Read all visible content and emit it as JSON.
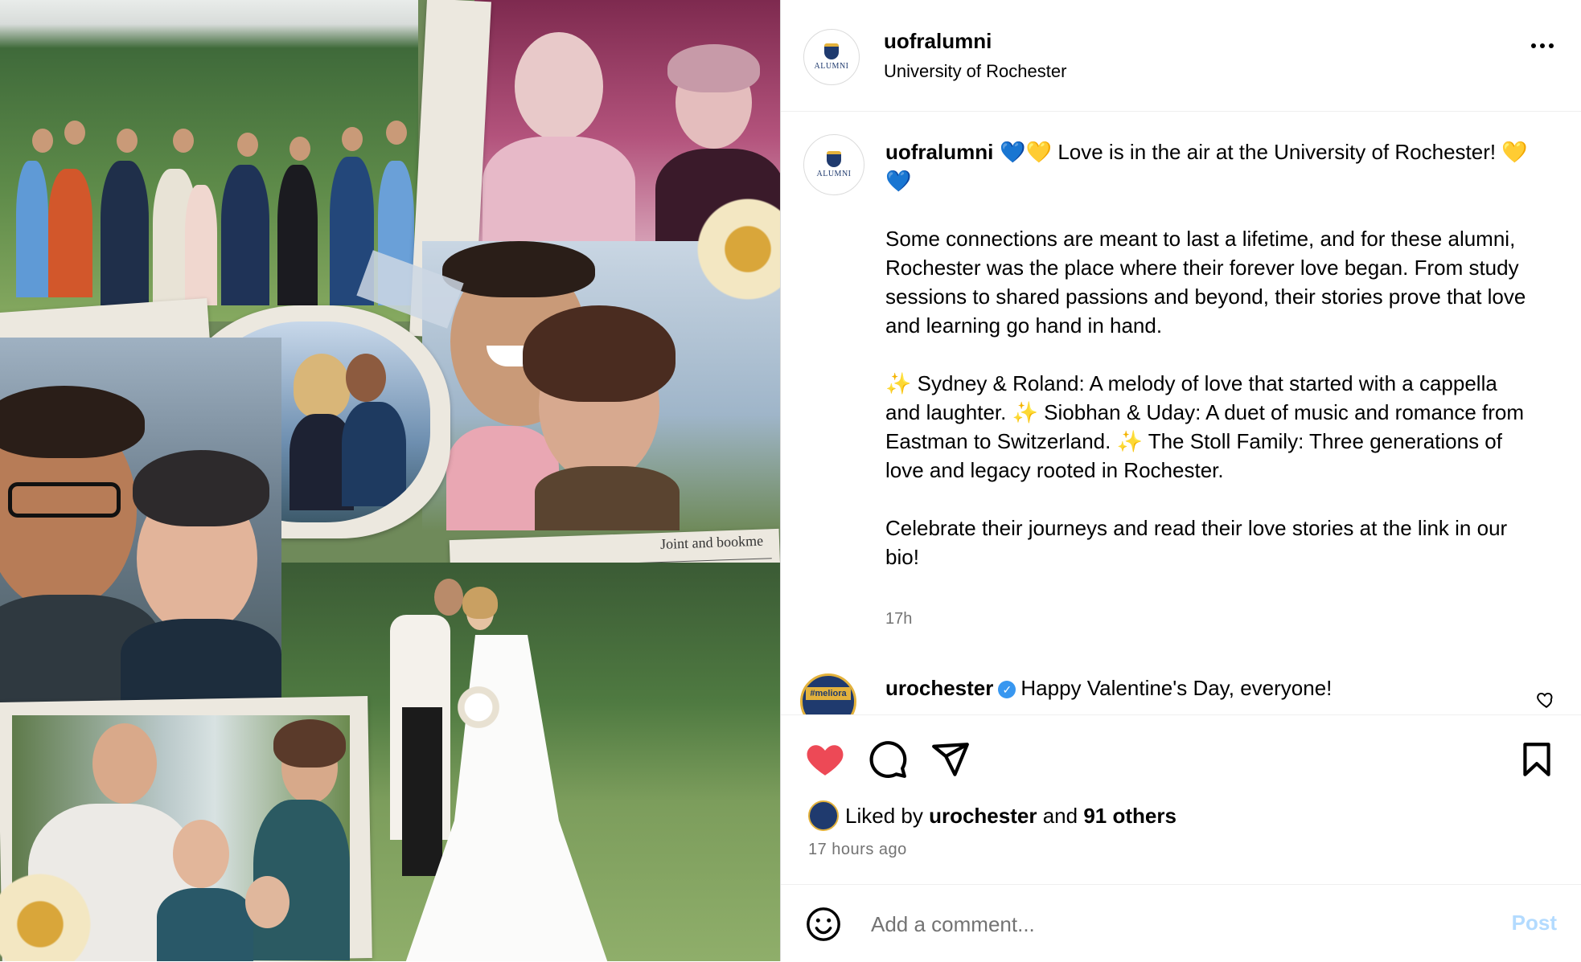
{
  "header": {
    "avatar_text": "ALUMNI",
    "username": "uofralumni",
    "subtitle": "University of Rochester"
  },
  "caption": {
    "username": "uofralumni",
    "line1": "💙💛 Love is in the air at the University of Rochester! 💛💙",
    "paragraph2": "Some connections are meant to last a lifetime, and for these alumni, Rochester was the place where their forever love began. From study sessions to shared passions and beyond, their stories prove that love and learning go hand in hand.",
    "paragraph3": "✨ Sydney & Roland: A melody of love that started with a cappella and laughter. ✨ Siobhan & Uday: A duet of music and romance from Eastman to Switzerland. ✨ The Stoll Family: Three generations of love and legacy rooted in Rochester.",
    "paragraph4": "Celebrate their journeys and read their love stories at the link in our bio!",
    "time": "17h"
  },
  "comment": {
    "avatar_text": "#meliora",
    "username": "urochester",
    "text": "Happy Valentine's Day, everyone!"
  },
  "likes": {
    "prefix": "Liked by",
    "user": "urochester",
    "middle": "and",
    "others": "91 others",
    "avatar_text": "#meliora"
  },
  "posted_ago": "17 hours ago",
  "add_comment": {
    "placeholder": "Add a comment...",
    "post_label": "Post"
  },
  "colors": {
    "like_red": "#ed4956",
    "link_blue_disabled": "#b3dbff",
    "secondary_text": "#737373",
    "brand_navy": "#1f3a6e",
    "brand_gold": "#e3b23c"
  },
  "icons": [
    "more-options-icon",
    "heart-icon",
    "comment-icon",
    "share-icon",
    "bookmark-icon",
    "emoji-icon",
    "verified-badge-icon"
  ],
  "media": {
    "sheet_music_text": "Joint and bookme"
  }
}
